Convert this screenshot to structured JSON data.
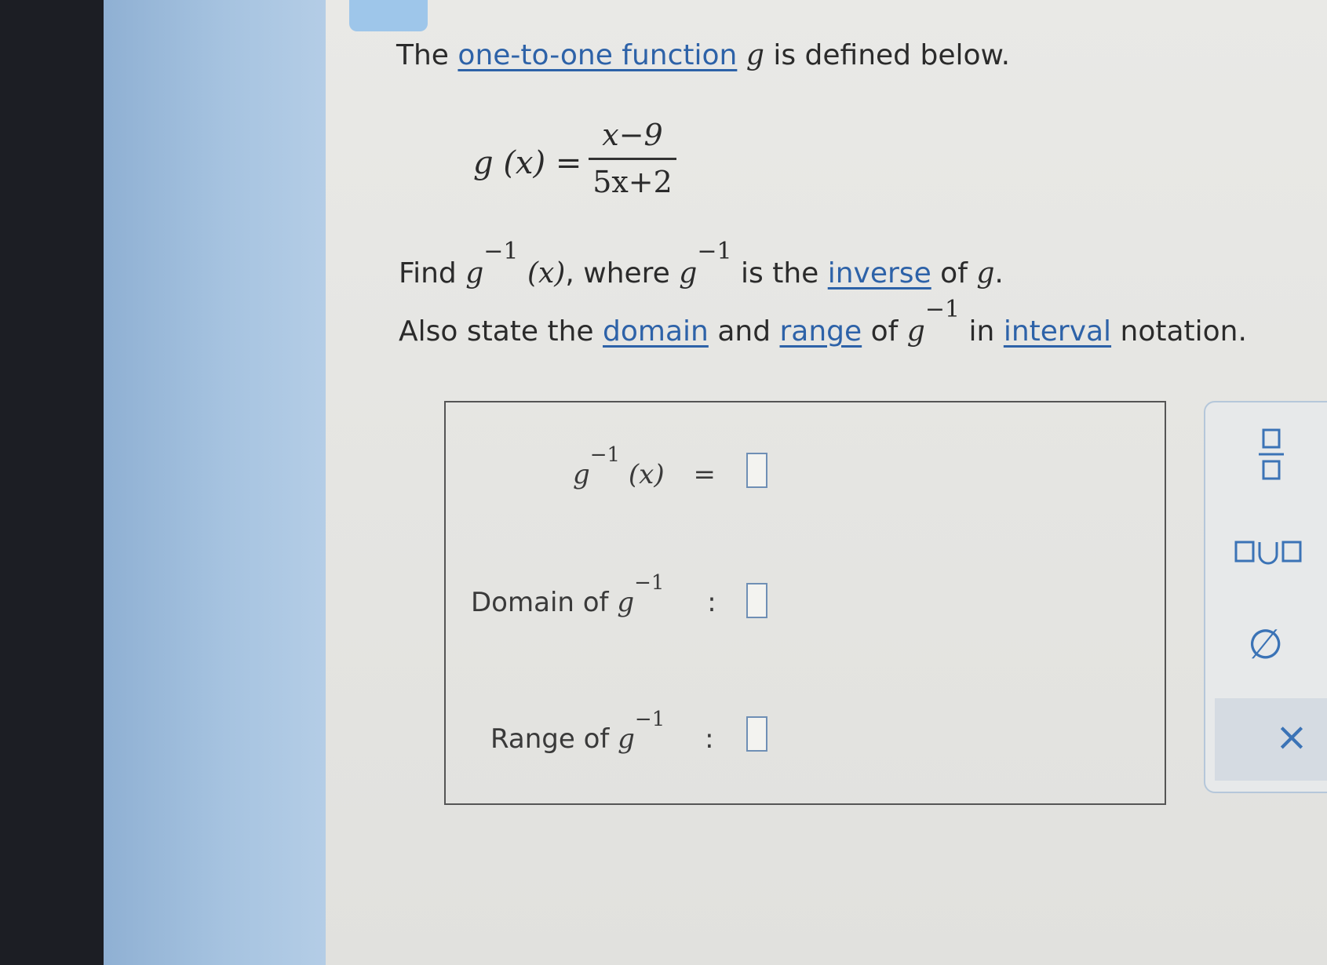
{
  "question": {
    "line1": {
      "prefix": "The",
      "link": "one-to-one function",
      "var": "g",
      "suffix": "is defined below."
    },
    "equation": {
      "lhs_fn": "g",
      "lhs_arg": "(x)",
      "equals": "=",
      "numerator": "x−9",
      "denominator": "5x+2"
    },
    "line2": {
      "find": "Find",
      "g": "g",
      "sup": "−1",
      "arg": "(x)",
      "where": ", where",
      "g2": "g",
      "sup2": "−1",
      "is_the": "is the",
      "link_inverse": "inverse",
      "of": "of",
      "g3": "g",
      "period": "."
    },
    "line3": {
      "prefix": "Also state the",
      "link_domain": "domain",
      "and": "and",
      "link_range": "range",
      "of": "of",
      "g": "g",
      "sup": "−1",
      "in": "in",
      "link_interval": "interval",
      "suffix": "notation."
    }
  },
  "answer_panel": {
    "row1": {
      "g": "g",
      "sup": "−1",
      "arg": "(x)",
      "equals": "=",
      "value": ""
    },
    "row2": {
      "label": "Domain of",
      "g": "g",
      "sup": "−1",
      "colon": ":",
      "value": ""
    },
    "row3": {
      "label": "Range of",
      "g": "g",
      "sup": "−1",
      "colon": ":",
      "value": ""
    }
  },
  "tools": {
    "fraction": "fraction-icon",
    "union": "∪",
    "empty_set": "∅",
    "clear": "×"
  },
  "colors": {
    "link": "#2d62a8",
    "sidebar": "#a6c3e0",
    "tool_icon": "#3b73b6"
  }
}
